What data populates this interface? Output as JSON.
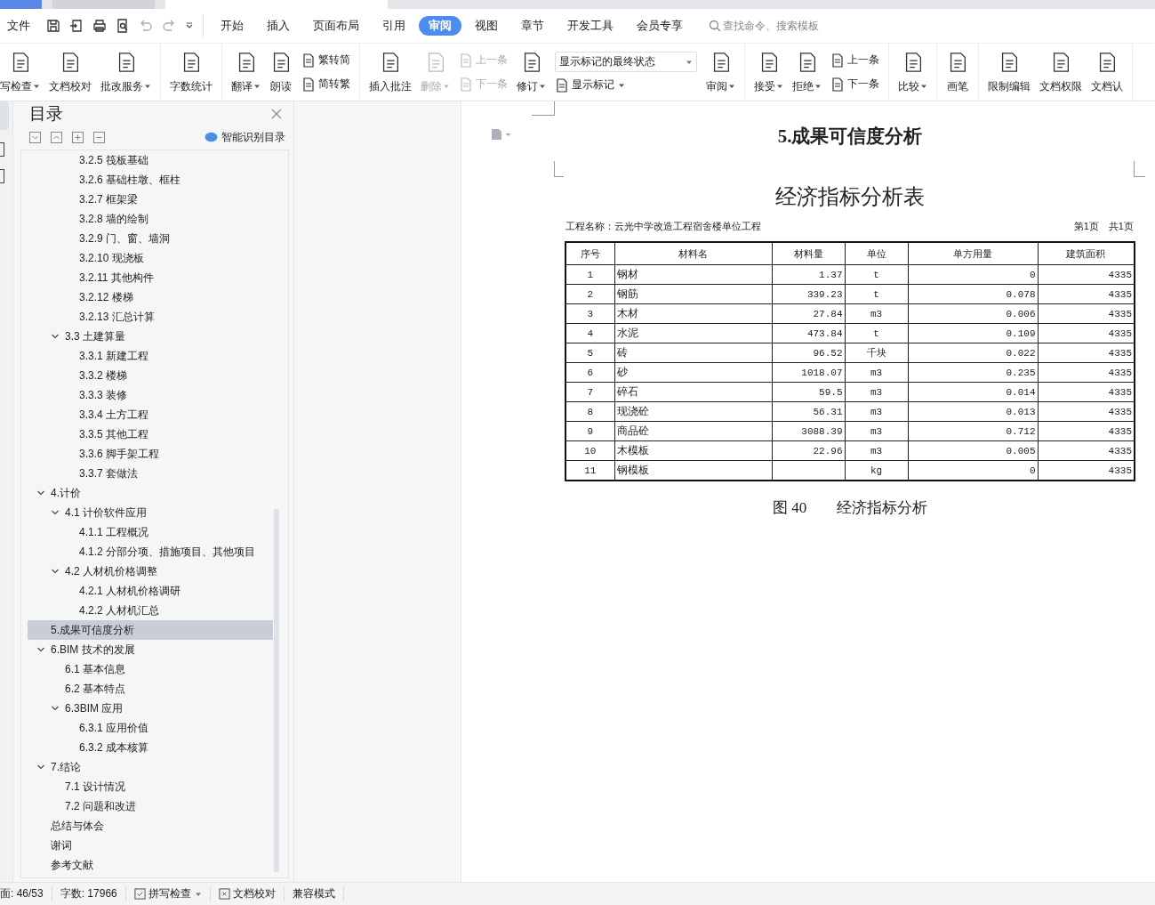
{
  "tab_strip": {
    "tabs": [
      {
        "selected": false
      },
      {
        "selected": false
      },
      {
        "selected": true
      }
    ]
  },
  "left_strip": {
    "tabs": [
      {
        "selected": true
      },
      {
        "selected": false
      },
      {
        "selected": false
      }
    ]
  },
  "menu_bar": {
    "file_menu": "文件",
    "tabs": [
      {
        "label": "开始",
        "selected": false
      },
      {
        "label": "插入",
        "selected": false
      },
      {
        "label": "页面布局",
        "selected": false
      },
      {
        "label": "引用",
        "selected": false
      },
      {
        "label": "审阅",
        "selected": true
      },
      {
        "label": "视图",
        "selected": false
      },
      {
        "label": "章节",
        "selected": false
      },
      {
        "label": "开发工具",
        "selected": false
      },
      {
        "label": "会员专享",
        "selected": false
      }
    ],
    "search": {
      "placeholder": "查找命令、搜索模板"
    }
  },
  "ribbon": {
    "groups": [
      [
        {
          "kind": "big",
          "label": "写检查",
          "dropdown": true,
          "disabled": false
        },
        {
          "kind": "big",
          "label": "文档校对",
          "dropdown": false,
          "disabled": false
        },
        {
          "kind": "big",
          "label": "批改服务",
          "dropdown": true,
          "disabled": false
        }
      ],
      [
        {
          "kind": "big",
          "label": "字数统计",
          "dropdown": false,
          "disabled": false
        }
      ],
      [
        {
          "kind": "big",
          "label": "翻译",
          "dropdown": true,
          "disabled": false
        },
        {
          "kind": "big",
          "label": "朗读",
          "dropdown": false,
          "disabled": false
        },
        {
          "kind": "pair",
          "rows": [
            {
              "label": "繁转简",
              "disabled": false
            },
            {
              "label": "简转繁",
              "disabled": false
            }
          ]
        }
      ],
      [
        {
          "kind": "big",
          "label": "插入批注",
          "dropdown": false,
          "disabled": false
        },
        {
          "kind": "big",
          "label": "删除",
          "dropdown": true,
          "disabled": true
        },
        {
          "kind": "pair",
          "rows": [
            {
              "label": "上一条",
              "disabled": true
            },
            {
              "label": "下一条",
              "disabled": true
            }
          ]
        },
        {
          "kind": "big",
          "label": "修订",
          "dropdown": true,
          "disabled": false
        },
        {
          "kind": "select",
          "value": "显示标记的最终状态",
          "sub_label": "显示标记"
        },
        {
          "kind": "big",
          "label": "审阅",
          "dropdown": true,
          "disabled": false
        }
      ],
      [
        {
          "kind": "big",
          "label": "接受",
          "dropdown": true,
          "disabled": false
        },
        {
          "kind": "big",
          "label": "拒绝",
          "dropdown": true,
          "disabled": false
        },
        {
          "kind": "pair",
          "rows": [
            {
              "label": "上一条",
              "disabled": false
            },
            {
              "label": "下一条",
              "disabled": false
            }
          ]
        }
      ],
      [
        {
          "kind": "big",
          "label": "比较",
          "dropdown": true,
          "disabled": false
        }
      ],
      [
        {
          "kind": "big",
          "label": "画笔",
          "dropdown": false,
          "disabled": false
        }
      ],
      [
        {
          "kind": "big",
          "label": "限制编辑",
          "dropdown": false,
          "disabled": false
        },
        {
          "kind": "big",
          "label": "文档权限",
          "dropdown": false,
          "disabled": false
        },
        {
          "kind": "big",
          "label": "文档认",
          "dropdown": false,
          "disabled": false
        }
      ]
    ]
  },
  "toc": {
    "title": "目录",
    "smart_button": "智能识别目录",
    "items": [
      {
        "children": [
          {
            "children": [
              {
                "label": "3.2.5 筏板基础",
                "selected": false
              },
              {
                "label": "3.2.6 基础柱墩、框柱",
                "selected": false
              },
              {
                "label": "3.2.7 框架梁",
                "selected": false
              },
              {
                "label": "3.2.8 墙的绘制",
                "selected": false
              },
              {
                "label": "3.2.9 门、窗、墙洞",
                "selected": false
              },
              {
                "label": "3.2.10 现浇板",
                "selected": false
              },
              {
                "label": "3.2.11 其他构件",
                "selected": false
              },
              {
                "label": "3.2.12 楼梯",
                "selected": false
              },
              {
                "label": "3.2.13 汇总计算",
                "selected": false
              }
            ]
          },
          {
            "label": "3.3 土建算量",
            "selected": false,
            "expanded": true,
            "children": [
              {
                "label": "3.3.1 新建工程",
                "selected": false
              },
              {
                "label": "3.3.2 楼梯",
                "selected": false
              },
              {
                "label": "3.3.3 装修",
                "selected": false
              },
              {
                "label": "3.3.4 土方工程",
                "selected": false
              },
              {
                "label": "3.3.5 其他工程",
                "selected": false
              },
              {
                "label": "3.3.6 脚手架工程",
                "selected": false
              },
              {
                "label": "3.3.7 套做法",
                "selected": false
              }
            ]
          }
        ]
      },
      {
        "label": "4.计价",
        "selected": false,
        "expanded": true,
        "children": [
          {
            "label": "4.1 计价软件应用",
            "selected": false,
            "expanded": true,
            "children": [
              {
                "label": "4.1.1 工程概况",
                "selected": false
              },
              {
                "label": "4.1.2 分部分项、措施项目、其他项目",
                "selected": false
              }
            ]
          },
          {
            "label": "4.2 人材机价格调整",
            "selected": false,
            "expanded": true,
            "children": [
              {
                "label": "4.2.1 人材机价格调研",
                "selected": false
              },
              {
                "label": "4.2.2 人材机汇总",
                "selected": false
              }
            ]
          }
        ]
      },
      {
        "label": "5.成果可信度分析",
        "selected": true
      },
      {
        "label": "6.BIM 技术的发展",
        "selected": false,
        "expanded": true,
        "children": [
          {
            "label": "6.1 基本信息",
            "selected": false
          },
          {
            "label": "6.2 基本特点",
            "selected": false
          },
          {
            "label": "6.3BIM 应用",
            "selected": false,
            "expanded": true,
            "children": [
              {
                "label": "6.3.1 应用价值",
                "selected": false
              },
              {
                "label": "6.3.2 成本核算",
                "selected": false
              }
            ]
          }
        ]
      },
      {
        "label": "7.结论",
        "selected": false,
        "expanded": true,
        "children": [
          {
            "label": "7.1 设计情况",
            "selected": false
          },
          {
            "label": "7.2 问题和改进",
            "selected": false
          }
        ]
      },
      {
        "label": "总结与体会",
        "selected": false
      },
      {
        "label": "谢词",
        "selected": false
      },
      {
        "label": "参考文献",
        "selected": false
      }
    ]
  },
  "document": {
    "heading": "5.成果可信度分析",
    "table_title": "经济指标分析表",
    "project": "工程名称：云光中学改造工程宿舍楼单位工程",
    "page_info": "第1页　共1页",
    "table": {
      "columns": [
        "序号",
        "材料名",
        "材料量",
        "单位",
        "单方用量",
        "建筑面积"
      ],
      "rows": [
        [
          "1",
          "钢材",
          "1.37",
          "t",
          "0",
          "4335"
        ],
        [
          "2",
          "钢筋",
          "339.23",
          "t",
          "0.078",
          "4335"
        ],
        [
          "3",
          "木材",
          "27.84",
          "m3",
          "0.006",
          "4335"
        ],
        [
          "4",
          "水泥",
          "473.84",
          "t",
          "0.109",
          "4335"
        ],
        [
          "5",
          "砖",
          "96.52",
          "千块",
          "0.022",
          "4335"
        ],
        [
          "6",
          "砂",
          "1018.07",
          "m3",
          "0.235",
          "4335"
        ],
        [
          "7",
          "碎石",
          "59.5",
          "m3",
          "0.014",
          "4335"
        ],
        [
          "8",
          "现浇砼",
          "56.31",
          "m3",
          "0.013",
          "4335"
        ],
        [
          "9",
          "商品砼",
          "3088.39",
          "m3",
          "0.712",
          "4335"
        ],
        [
          "10",
          "木模板",
          "22.96",
          "m3",
          "0.005",
          "4335"
        ],
        [
          "11",
          "钢模板",
          "",
          "kg",
          "0",
          "4335"
        ]
      ]
    },
    "caption": "图 40　　经济指标分析"
  },
  "status_bar": {
    "page": "面: 46/53",
    "word_count": "字数: 17966",
    "spell_check": "拼写检查",
    "proofread": "文档校对",
    "mode": "兼容模式"
  }
}
